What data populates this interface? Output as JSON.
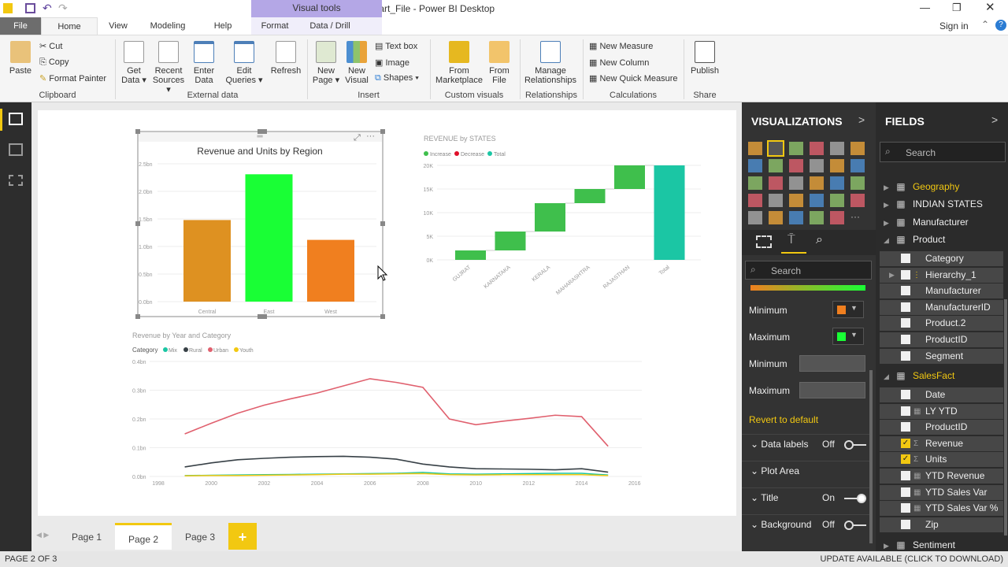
{
  "window": {
    "title": "Start_File - Power BI Desktop",
    "context_tab": "Visual tools",
    "sign_in": "Sign in"
  },
  "tabs": [
    "File",
    "Home",
    "View",
    "Modeling",
    "Help",
    "Format",
    "Data / Drill"
  ],
  "ribbon": {
    "clipboard": {
      "paste": "Paste",
      "cut": "Cut",
      "copy": "Copy",
      "format_painter": "Format Painter",
      "group": "Clipboard"
    },
    "external": {
      "get_data": "Get Data ▾",
      "recent": "Recent Sources ▾",
      "enter": "Enter Data",
      "edit": "Edit Queries ▾",
      "refresh": "Refresh",
      "group": "External data"
    },
    "insert": {
      "new_page": "New Page ▾",
      "new_visual": "New Visual",
      "text_box": "Text box",
      "image": "Image",
      "shapes": "Shapes ▾",
      "group": "Insert"
    },
    "custom": {
      "marketplace": "From Marketplace",
      "file": "From File",
      "group": "Custom visuals"
    },
    "rel": {
      "manage": "Manage Relationships",
      "group": "Relationships"
    },
    "calc": {
      "measure": "New Measure",
      "column": "New Column",
      "quick": "New Quick Measure",
      "group": "Calculations"
    },
    "share": {
      "publish": "Publish",
      "group": "Share"
    }
  },
  "pages": {
    "tabs": [
      "Page 1",
      "Page 2",
      "Page 3"
    ],
    "add": "+",
    "active": "Page 2",
    "status": "PAGE 2 OF 3",
    "update": "UPDATE AVAILABLE (CLICK TO DOWNLOAD)"
  },
  "visualizations": {
    "title": "VISUALIZATIONS",
    "search": "Search",
    "minimum": "Minimum",
    "maximum": "Maximum",
    "minimum2": "Minimum",
    "maximum2": "Maximum",
    "min_color": "#f07f1f",
    "max_color": "#19ff35",
    "revert": "Revert to default",
    "sections": [
      {
        "label": "Data labels",
        "state": "Off"
      },
      {
        "label": "Plot Area",
        "state": ""
      },
      {
        "label": "Title",
        "state": "On"
      },
      {
        "label": "Background",
        "state": "Off"
      }
    ]
  },
  "fields": {
    "title": "FIELDS",
    "search": "Search",
    "tables": [
      "Geography",
      "INDIAN STATES",
      "Manufacturer",
      "Product",
      "SalesFact",
      "Sentiment"
    ],
    "product_fields": [
      "Category",
      "Hierarchy_1",
      "Manufacturer",
      "ManufacturerID",
      "Product.2",
      "ProductID",
      "Segment"
    ],
    "sales_fields": [
      {
        "name": "Date",
        "icon": "",
        "checked": false
      },
      {
        "name": "LY YTD",
        "icon": "calc",
        "checked": false
      },
      {
        "name": "ProductID",
        "icon": "",
        "checked": false
      },
      {
        "name": "Revenue",
        "icon": "sigma",
        "checked": true
      },
      {
        "name": "Units",
        "icon": "sigma",
        "checked": true
      },
      {
        "name": "YTD Revenue",
        "icon": "calc",
        "checked": false
      },
      {
        "name": "YTD Sales Var",
        "icon": "calc",
        "checked": false
      },
      {
        "name": "YTD Sales Var %",
        "icon": "calc",
        "checked": false
      },
      {
        "name": "Zip",
        "icon": "",
        "checked": false
      }
    ]
  },
  "chart_data": [
    {
      "type": "bar",
      "title": "Revenue and Units by Region",
      "categories": [
        "Central",
        "East",
        "West"
      ],
      "values": [
        1.48,
        2.31,
        1.12
      ],
      "colors": [
        "#de9121",
        "#19ff35",
        "#f07f1f"
      ],
      "ylim": [
        0,
        2.5
      ],
      "yticks": [
        "0.0bn",
        "0.5bn",
        "1.0bn",
        "1.5bn",
        "2.0bn",
        "2.5bn"
      ]
    },
    {
      "type": "waterfall",
      "title": "REVENUE by STATES",
      "legend": [
        "Increase",
        "Decrease",
        "Total"
      ],
      "legend_colors": [
        "#3fbf4c",
        "#e0102a",
        "#1bc6a4"
      ],
      "categories": [
        "GUJRAT",
        "KARNATAKA",
        "KERALA",
        "MAHARASHTRA",
        "RAJASTHAN",
        "Total"
      ],
      "values": [
        2000,
        4000,
        6000,
        3000,
        5000,
        20000
      ],
      "ylim": [
        0,
        20000
      ],
      "yticks": [
        "0K",
        "5K",
        "10K",
        "15K",
        "20K"
      ]
    },
    {
      "type": "line",
      "title": "Revenue by Year and Category",
      "legend_title": "Category",
      "x": [
        1999,
        2000,
        2001,
        2002,
        2003,
        2004,
        2005,
        2006,
        2007,
        2008,
        2009,
        2010,
        2011,
        2012,
        2013,
        2014,
        2015
      ],
      "xticks": [
        "1998",
        "2000",
        "2002",
        "2004",
        "2006",
        "2008",
        "2010",
        "2012",
        "2014",
        "2016"
      ],
      "yticks": [
        "0.0bn",
        "0.1bn",
        "0.2bn",
        "0.3bn",
        "0.4bn"
      ],
      "ylim": [
        0,
        0.4
      ],
      "series": [
        {
          "name": "Mix",
          "color": "#1bc6a4",
          "values": [
            0.003,
            0.004,
            0.005,
            0.006,
            0.007,
            0.008,
            0.009,
            0.01,
            0.011,
            0.014,
            0.009,
            0.008,
            0.009,
            0.01,
            0.011,
            0.011,
            0.005
          ]
        },
        {
          "name": "Rural",
          "color": "#374046",
          "values": [
            0.033,
            0.047,
            0.058,
            0.063,
            0.067,
            0.069,
            0.07,
            0.067,
            0.06,
            0.043,
            0.033,
            0.027,
            0.026,
            0.025,
            0.023,
            0.027,
            0.015
          ]
        },
        {
          "name": "Urban",
          "color": "#e0606e",
          "values": [
            0.148,
            0.185,
            0.22,
            0.248,
            0.27,
            0.29,
            0.315,
            0.34,
            0.327,
            0.31,
            0.2,
            0.18,
            0.192,
            0.202,
            0.213,
            0.208,
            0.105
          ]
        },
        {
          "name": "Youth",
          "color": "#f2c811",
          "values": [
            0.002,
            0.003,
            0.003,
            0.004,
            0.005,
            0.006,
            0.008,
            0.008,
            0.009,
            0.01,
            0.006,
            0.005,
            0.006,
            0.006,
            0.006,
            0.006,
            0.003
          ]
        }
      ]
    }
  ]
}
